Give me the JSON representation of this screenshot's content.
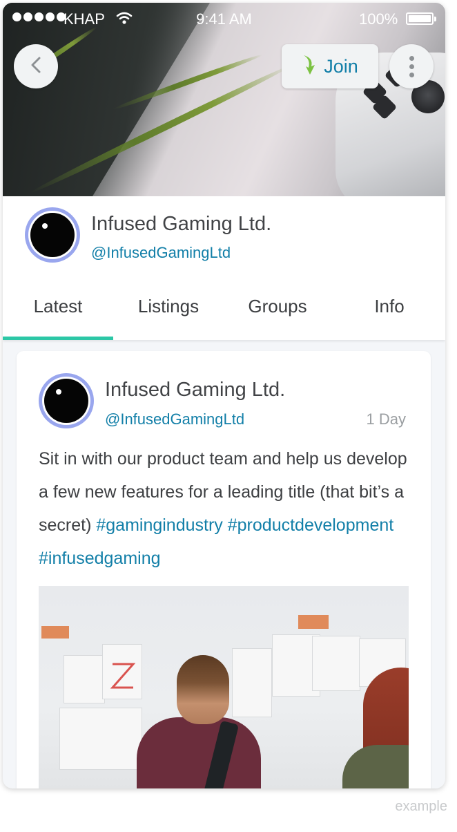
{
  "status_bar": {
    "carrier": "KHAP",
    "time": "9:41 AM",
    "battery": "100%"
  },
  "header": {
    "join_label": "Join"
  },
  "profile": {
    "name": "Infused Gaming Ltd.",
    "handle": "@InfusedGamingLtd"
  },
  "tabs": [
    {
      "label": "Latest"
    },
    {
      "label": "Listings"
    },
    {
      "label": "Groups"
    },
    {
      "label": "Info"
    }
  ],
  "post": {
    "author": "Infused Gaming Ltd.",
    "handle": "@InfusedGamingLtd",
    "time": "1 Day",
    "text": "Sit in with our product team and help us develop a few new features for a leading title (that bit’s a secret)",
    "tags": [
      "#gamingindustry",
      "#productdevelopment",
      "#infusedgaming"
    ]
  },
  "footer": {
    "label": "example"
  },
  "colors": {
    "accent_teal": "#2cc7a6",
    "link_blue": "#127fa8",
    "avatar_ring": "#99a6ee",
    "join_arrow": "#7cc242"
  },
  "icons": {
    "back": "chevron-left-icon",
    "join": "join-arrow-icon",
    "more": "more-vertical-icon",
    "signal": "signal-dots-icon",
    "wifi": "wifi-icon",
    "battery": "battery-icon"
  }
}
